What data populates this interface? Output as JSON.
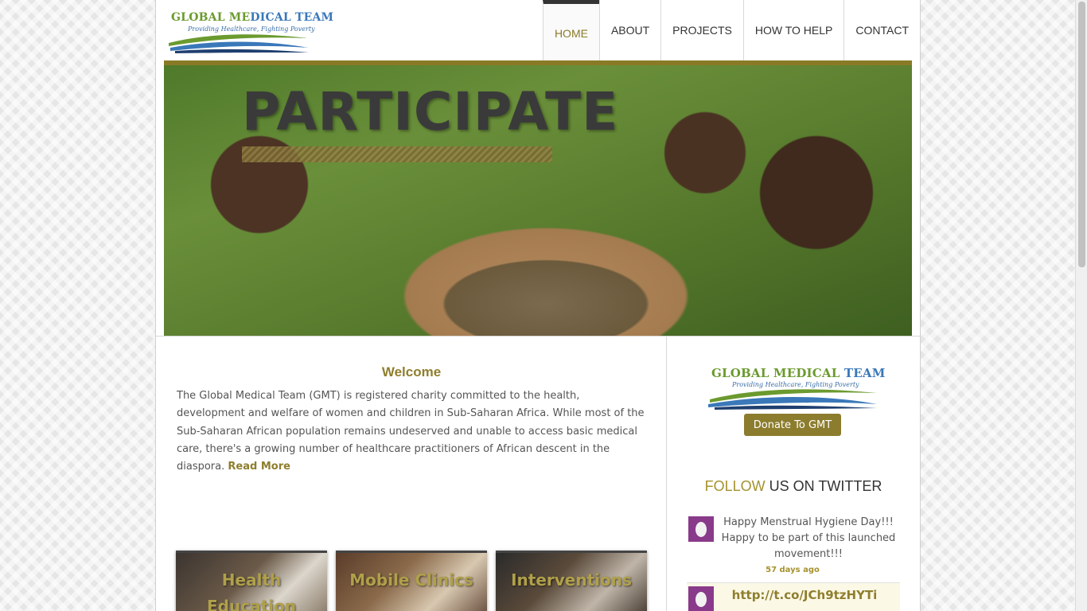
{
  "header": {
    "logo": {
      "title_part1": "GLOBAL ME",
      "title_part2": "DICAL TEAM",
      "tagline": "Providing Healthcare, Fighting Poverty"
    },
    "nav": [
      {
        "label": "HOME",
        "active": true
      },
      {
        "label": "ABOUT",
        "active": false
      },
      {
        "label": "PROJECTS",
        "active": false
      },
      {
        "label": "HOW TO HELP",
        "active": false
      },
      {
        "label": "CONTACT",
        "active": false
      }
    ]
  },
  "banner": {
    "title": "PARTICIPATE"
  },
  "welcome": {
    "title": "Welcome",
    "text": "The Global Medical Team (GMT) is registered charity committed to the health, development and welfare of women and children in Sub-Saharan Africa. While most of the Sub-Saharan African population remains undeserved and unable to access basic medical care, there's a growing number of healthcare practitioners of African descent in the diaspora. ",
    "read_more": "Read More"
  },
  "cards": [
    {
      "label": "Health Education"
    },
    {
      "label": "Mobile Clinics"
    },
    {
      "label": "Interventions"
    }
  ],
  "sidebar": {
    "logo": {
      "title_part1": "GLOBAL MEDICAL ",
      "title_part2": "TEAM",
      "tagline": "Providing Healthcare, Fighting Poverty"
    },
    "donate_label": "Donate To GMT",
    "follow": {
      "accent": "FOLLOW",
      "rest": " US ON TWITTER"
    },
    "tweets": [
      {
        "text": "Happy Menstrual Hygiene Day!!! Happy to be part of this launched movement!!!",
        "time": "57 days ago"
      },
      {
        "link": "http://t.co/JCh9tzHYTi"
      }
    ]
  },
  "colors": {
    "accent_gold": "#8f7e2d",
    "nav_active": "#8a7a2a",
    "avatar_purple": "#8a3a8a"
  }
}
